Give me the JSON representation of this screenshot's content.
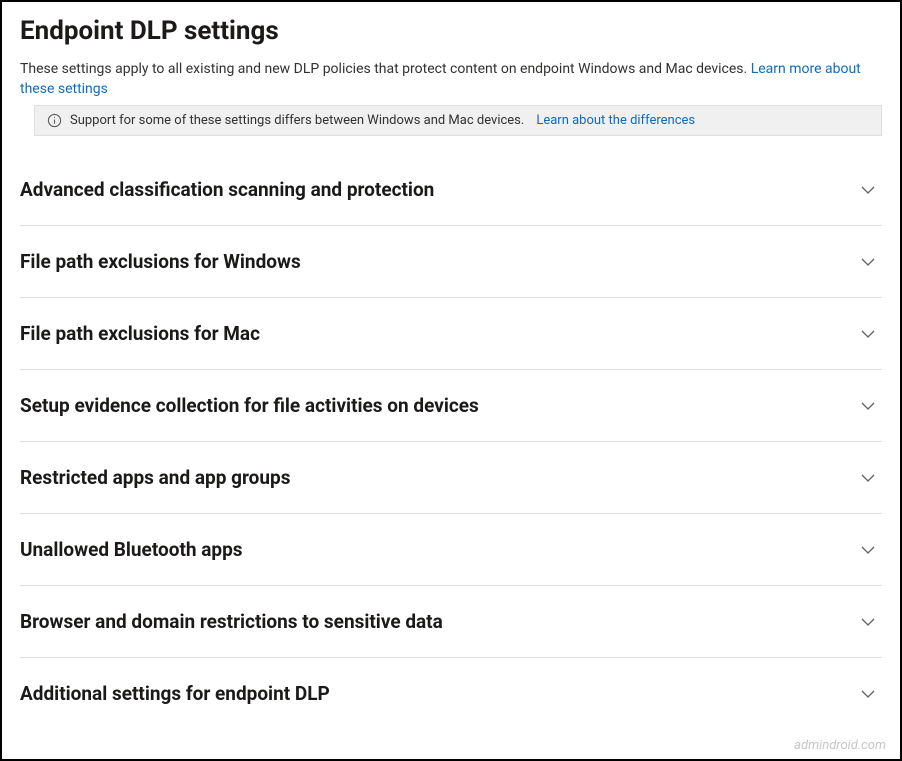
{
  "header": {
    "title": "Endpoint DLP settings",
    "description_text": "These settings apply to all existing and new DLP policies that protect content on endpoint Windows and Mac devices. ",
    "learn_more_label": "Learn more about these settings"
  },
  "banner": {
    "text": "Support for some of these settings differs between Windows and Mac devices.",
    "link_label": "Learn about the differences"
  },
  "sections": [
    {
      "title": "Advanced classification scanning and protection"
    },
    {
      "title": "File path exclusions for Windows"
    },
    {
      "title": "File path exclusions for Mac"
    },
    {
      "title": "Setup evidence collection for file activities on devices"
    },
    {
      "title": "Restricted apps and app groups"
    },
    {
      "title": "Unallowed Bluetooth apps"
    },
    {
      "title": "Browser and domain restrictions to sensitive data"
    },
    {
      "title": "Additional settings for endpoint DLP"
    }
  ],
  "watermark": "admindroid.com"
}
